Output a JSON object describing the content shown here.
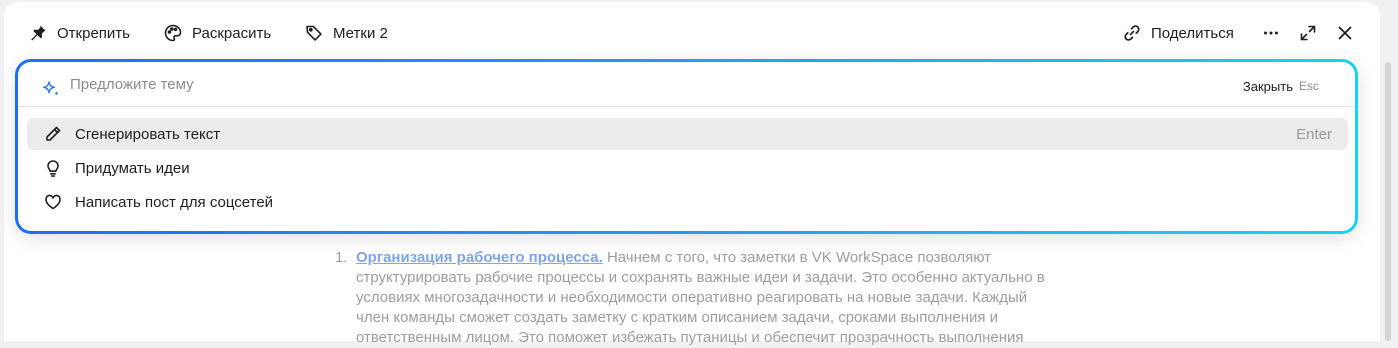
{
  "toolbar": {
    "unpin_label": "Открепить",
    "colorize_label": "Раскрасить",
    "tags_label": "Метки 2",
    "share_label": "Поделиться"
  },
  "ai_popup": {
    "topic_placeholder": "Предложите тему",
    "close_label": "Закрыть",
    "close_key": "Esc",
    "items": [
      {
        "label": "Сгенерировать текст",
        "shortcut": "Enter",
        "icon": "pencil-icon"
      },
      {
        "label": "Придумать идеи",
        "icon": "lightbulb-icon"
      },
      {
        "label": "Написать пост для соцсетей",
        "icon": "heart-icon"
      }
    ]
  },
  "document": {
    "list_number": "1.",
    "link_text": "Организация рабочего процесса.",
    "body_text": " Начнем с того, что заметки в VK WorkSpace позволяют структурировать рабочие процессы и сохранять важные идеи и задачи. Это особенно актуально в условиях многозадачности и необходимости оперативно реагировать на новые задачи. Каждый член команды сможет создать заметку с кратким описанием задачи, сроками выполнения и ответственным лицом. Это поможет избежать путаницы и обеспечит прозрачность выполнения"
  },
  "colors": {
    "accent_gradient_start": "#1c6ef2",
    "accent_gradient_end": "#15d3f2",
    "link": "#7fa4ee"
  }
}
